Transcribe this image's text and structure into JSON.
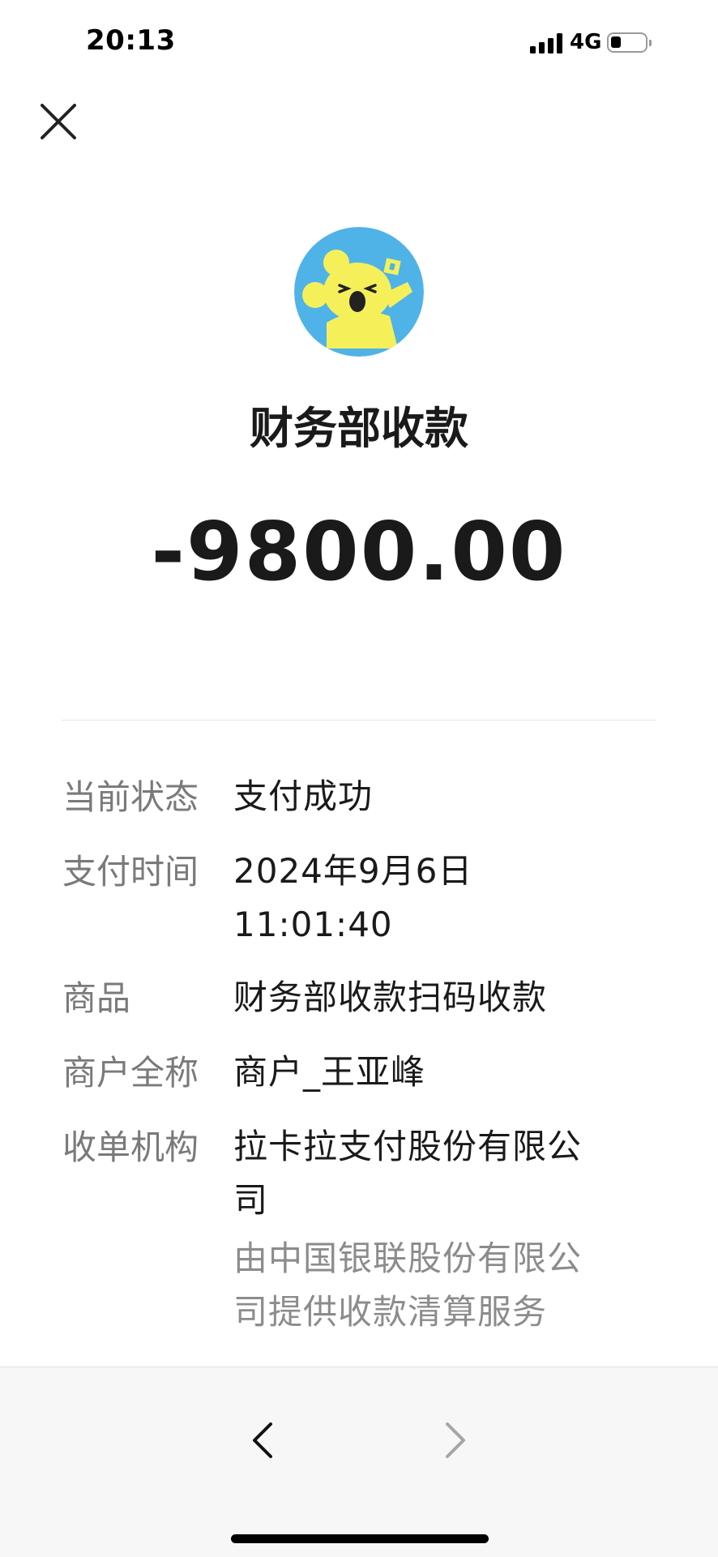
{
  "status_bar": {
    "time": "20:13",
    "network": "4G",
    "battery_level": 0.3
  },
  "header": {
    "close_icon": "close-icon"
  },
  "merchant": {
    "avatar_icon": "koala-avatar-icon",
    "title": "财务部收款"
  },
  "amount": "-9800.00",
  "details": [
    {
      "label": "当前状态",
      "value": "支付成功"
    },
    {
      "label": "支付时间",
      "value": "2024年9月6日\n11:01:40"
    },
    {
      "label": "商品",
      "value": "财务部收款扫码收款"
    },
    {
      "label": "商户全称",
      "value": "商户_王亚峰"
    },
    {
      "label": "收单机构",
      "value": "拉卡拉支付股份有限公司",
      "sub": "由中国银联股份有限公司提供收款清算服务"
    }
  ],
  "bottom_nav": {
    "back_icon": "chevron-left-icon",
    "forward_icon": "chevron-right-icon"
  },
  "colors": {
    "avatar_bg": "#4fb3e8",
    "koala": "#f5f05a",
    "label": "#7a7a7a",
    "text": "#1a1a1a"
  }
}
